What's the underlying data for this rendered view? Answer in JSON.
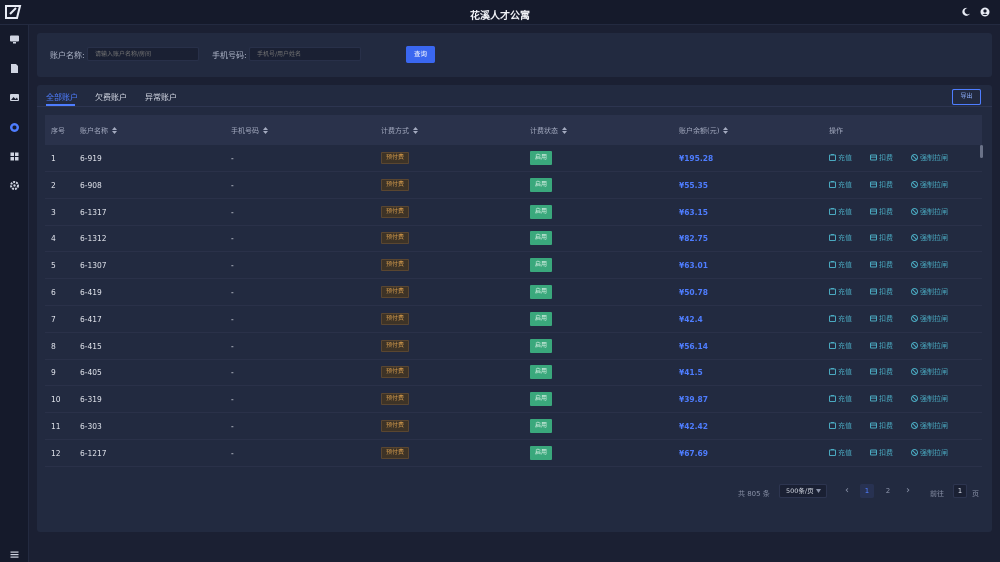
{
  "app": {
    "title": "花溪人才公寓"
  },
  "icons": {
    "logo": "logo-mark",
    "theme": "moon-icon",
    "user": "user-icon",
    "sidebar": [
      "monitor-icon",
      "file-icon",
      "image-icon",
      "shield-icon",
      "grid-icon",
      "gear-icon",
      "menu-icon"
    ]
  },
  "colors": {
    "accent": "#3a67f0",
    "balance": "#4e7dff",
    "fee_badge": "#d49b4d",
    "status_badge": "#3aa87c",
    "action": "#4aa9c0"
  },
  "search": {
    "account_label": "账户名称:",
    "account_placeholder": "请输入账户名称/房间",
    "phone_label": "手机号码:",
    "phone_placeholder": "手机号/用户姓名",
    "query_button": "查询"
  },
  "tabs": [
    {
      "label": "全部账户",
      "active": true
    },
    {
      "label": "欠费账户",
      "active": false
    },
    {
      "label": "异常账户",
      "active": false
    }
  ],
  "export_button": "导出",
  "table": {
    "headers": {
      "index": "序号",
      "account": "账户名称",
      "phone": "手机号码",
      "billing_method": "计费方式",
      "billing_status": "计费状态",
      "balance": "账户余额(元)",
      "actions": "操作"
    },
    "actions": {
      "recharge": "充值",
      "deduct": "扣费",
      "force_switch": "强制拉闸"
    },
    "rows": [
      {
        "index": "1",
        "account": "6-919",
        "phone": "-",
        "billing": "预付费",
        "status": "启用",
        "balance": "¥195.28"
      },
      {
        "index": "2",
        "account": "6-908",
        "phone": "-",
        "billing": "预付费",
        "status": "启用",
        "balance": "¥55.35"
      },
      {
        "index": "3",
        "account": "6-1317",
        "phone": "-",
        "billing": "预付费",
        "status": "启用",
        "balance": "¥63.15"
      },
      {
        "index": "4",
        "account": "6-1312",
        "phone": "-",
        "billing": "预付费",
        "status": "启用",
        "balance": "¥82.75"
      },
      {
        "index": "5",
        "account": "6-1307",
        "phone": "-",
        "billing": "预付费",
        "status": "启用",
        "balance": "¥63.01"
      },
      {
        "index": "6",
        "account": "6-419",
        "phone": "-",
        "billing": "预付费",
        "status": "启用",
        "balance": "¥50.78"
      },
      {
        "index": "7",
        "account": "6-417",
        "phone": "-",
        "billing": "预付费",
        "status": "启用",
        "balance": "¥42.4"
      },
      {
        "index": "8",
        "account": "6-415",
        "phone": "-",
        "billing": "预付费",
        "status": "启用",
        "balance": "¥56.14"
      },
      {
        "index": "9",
        "account": "6-405",
        "phone": "-",
        "billing": "预付费",
        "status": "启用",
        "balance": "¥41.5"
      },
      {
        "index": "10",
        "account": "6-319",
        "phone": "-",
        "billing": "预付费",
        "status": "启用",
        "balance": "¥39.87"
      },
      {
        "index": "11",
        "account": "6-303",
        "phone": "-",
        "billing": "预付费",
        "status": "启用",
        "balance": "¥42.42"
      },
      {
        "index": "12",
        "account": "6-1217",
        "phone": "-",
        "billing": "预付费",
        "status": "启用",
        "balance": "¥67.69"
      }
    ]
  },
  "pagination": {
    "total_text": "共 805 条",
    "page_size": "500条/页",
    "prev": "‹",
    "pages": [
      "1",
      "2"
    ],
    "current_page": "1",
    "next": "›",
    "jump_prefix": "前往",
    "jump_value": "1",
    "jump_suffix": "页"
  }
}
